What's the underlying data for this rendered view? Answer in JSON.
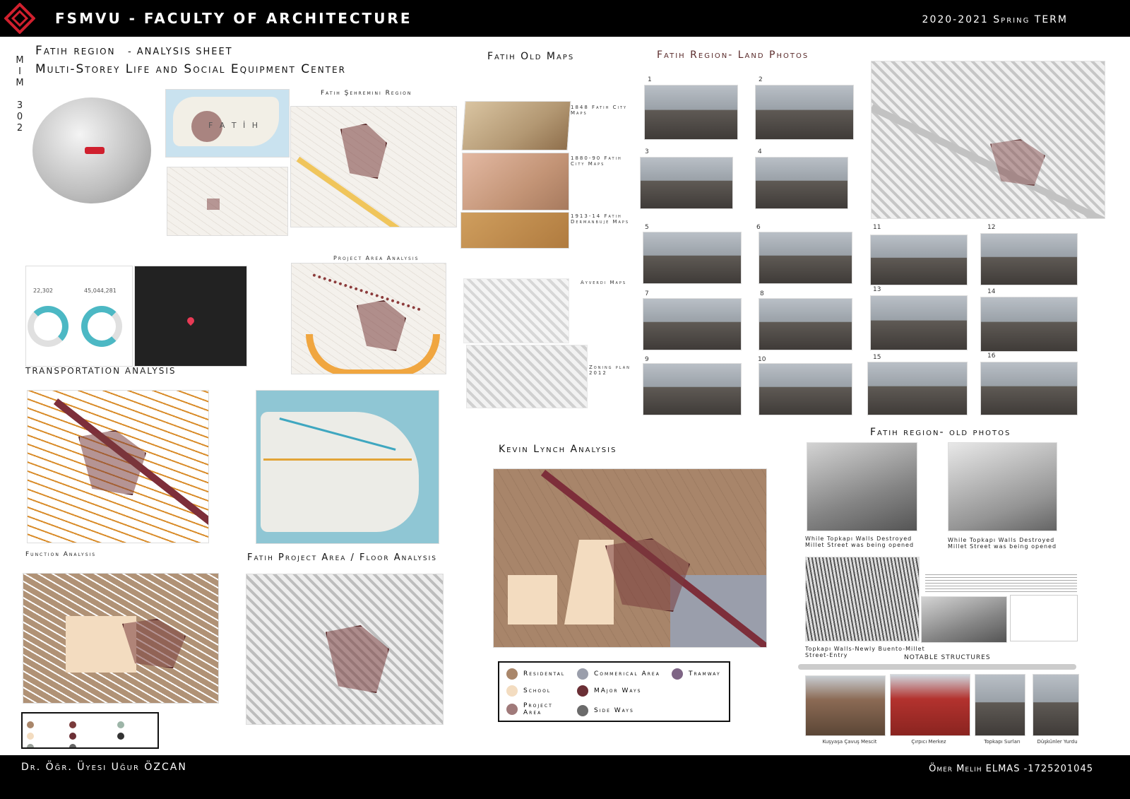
{
  "header": {
    "faculty": "FSMVU - FACULTY OF ARCHITECTURE",
    "term": "2020-2021 Spring TERM"
  },
  "vertical_code": [
    "M",
    "I",
    "M",
    "",
    "3",
    "0",
    "2"
  ],
  "titles": {
    "region": "Fatih region",
    "sheet": "- ANALYSIS SHEET",
    "project": "Multi-Storey Life and Social Equipment Center",
    "sehremini": "Fatih Şehremini Region",
    "project_area": "Project Area Analysis",
    "old_maps": "Fatih Old Maps",
    "land_photos": "Fatih Region- Land Photos",
    "transportation": "TRANSPORTATION ANALYSIS",
    "function": "Function Analysis",
    "floor": "Fatih Project Area / Floor Analysis",
    "kevin": "Kevin Lynch Analysis",
    "old_photos": "Fatih region- old photos",
    "notable": "NOTABLE STRUCTURES"
  },
  "fatih_map_label": "F A T İ H",
  "stats": {
    "stat1": "22,302",
    "stat2": "45,044,281"
  },
  "old_maps": [
    "1848 Fatih City Maps",
    "1880-90 Fatih City Maps",
    "1913-14 Fatih Dermanbuje Maps",
    "Ayverdi Maps",
    "Zoning plan 2012"
  ],
  "photo_numbers": [
    "1",
    "2",
    "3",
    "4",
    "5",
    "6",
    "7",
    "8",
    "9",
    "10",
    "11",
    "12",
    "13",
    "14",
    "15",
    "16"
  ],
  "kevin_legend": [
    {
      "label": "Residental",
      "color": "#a9866a"
    },
    {
      "label": "Commerical Area",
      "color": "#9a9eab"
    },
    {
      "label": "Tramway",
      "color": "#7e6585"
    },
    {
      "label": "School",
      "color": "#f3dcc0"
    },
    {
      "label": "MAjor Ways",
      "color": "#6b2f35"
    },
    {
      "label": "Project Area",
      "color": "#a07a7a"
    },
    {
      "label": "Side Ways",
      "color": "#6b6b6b"
    }
  ],
  "old_photo_captions": [
    "While Topkapı Walls Destroyed Millet Street was being opened",
    "While Topkapı Walls Destroyed Millet Street was being opened",
    "Topkapı Walls-Newly Buento-Millet Street-Entry"
  ],
  "notable_captions": [
    "Kuşyaşa Çavuş Mescit",
    "Çırpıcı Merkez",
    "Topkapı Surları",
    "Düşkünler Yurdu"
  ],
  "footer": {
    "advisor": "Dr. Öğr. Üyesi Uğur ÖZCAN",
    "student": "Ömer Melih ELMAS -1725201045"
  },
  "colors": {
    "project": "#7a3b3b",
    "street": "#d98c2a",
    "tram": "#7d2e3a",
    "header_bg": "#000000"
  }
}
